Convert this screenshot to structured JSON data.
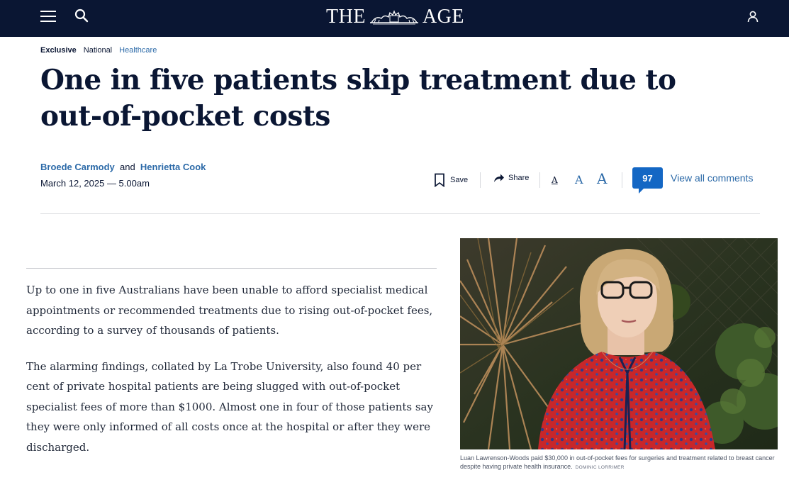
{
  "header": {
    "logo_left": "THE",
    "logo_right": "AGE",
    "icons": [
      "menu-icon",
      "search-icon",
      "crest-icon",
      "account-icon"
    ],
    "background": "#0a1633"
  },
  "tags": {
    "exclusive": "Exclusive",
    "section": "National",
    "topic": "Healthcare"
  },
  "article": {
    "headline": "One in five patients skip treatment due to out-of-pocket costs",
    "author1": "Broede Carmody",
    "author_joiner": "and",
    "author2": "Henrietta Cook",
    "date": "March 12, 2025 — 5.00am",
    "paragraphs": [
      "Up to one in five Australians have been unable to afford specialist medical appointments or recommended treatments due to rising out-of-pocket fees, according to a survey of thousands of patients.",
      "The alarming findings, collated by La Trobe University, also found 40 per cent of private hospital patients are being slugged with out-of-pocket specialist fees of more than $1000. Almost one in four of those patients say they were only informed of all costs once at the hospital or after they were discharged."
    ]
  },
  "tools": {
    "save_label": "Save",
    "share_label": "Share",
    "font_small": "A",
    "font_medium": "A",
    "font_large": "A",
    "comment_count": "97",
    "view_comments": "View all comments",
    "accent": "#1467c4",
    "link_color": "#2c6aa8"
  },
  "photo": {
    "caption": "Luan Lawrenson-Woods paid $30,000 in out-of-pocket fees for surgeries and treatment related to breast cancer despite having private health insurance.",
    "credit": "DOMINIC LORRIMER"
  }
}
